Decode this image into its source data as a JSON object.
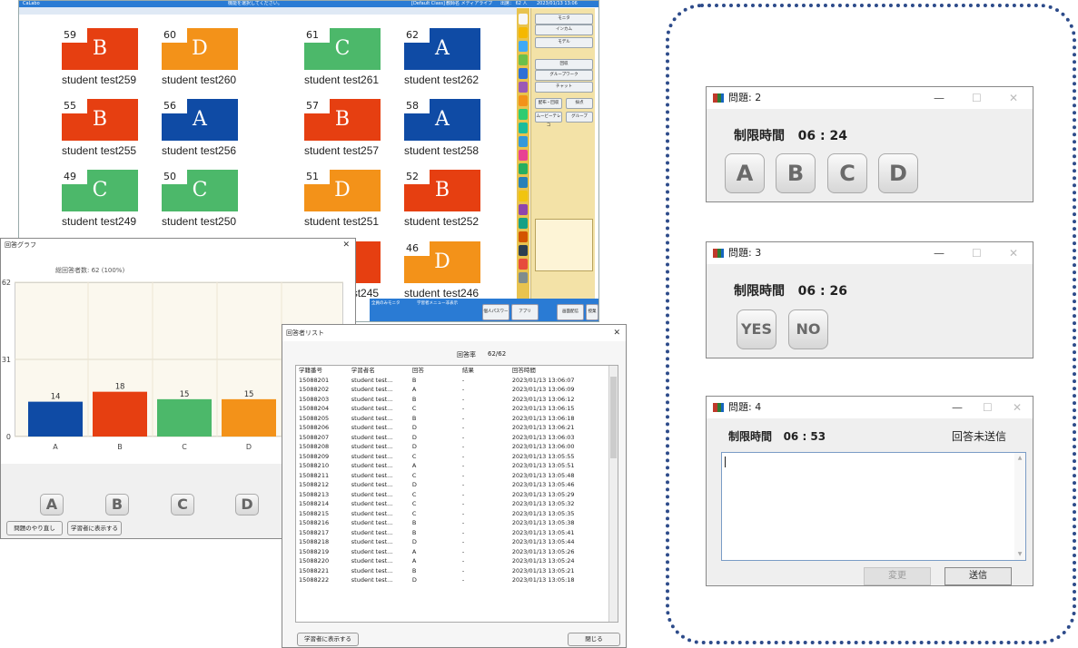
{
  "dashboard": {
    "topbar": {
      "app": "CaLabo",
      "message": "機能を選択してください。",
      "class": "[Default Class]",
      "teacher": "教師名 メディアライブ",
      "count": "出席： 62 人",
      "datetime": "2023/01/13 13:06"
    },
    "tiles": [
      {
        "num": "59",
        "letter": "B",
        "name": "student test259",
        "color": "#e63f11"
      },
      {
        "num": "60",
        "letter": "D",
        "name": "student test260",
        "color": "#f39219"
      },
      {
        "num": "61",
        "letter": "C",
        "name": "student test261",
        "color": "#4cb86a"
      },
      {
        "num": "62",
        "letter": "A",
        "name": "student test262",
        "color": "#0f4ba5"
      },
      {
        "num": "55",
        "letter": "B",
        "name": "student test255",
        "color": "#e63f11"
      },
      {
        "num": "56",
        "letter": "A",
        "name": "student test256",
        "color": "#0f4ba5"
      },
      {
        "num": "57",
        "letter": "B",
        "name": "student test257",
        "color": "#e63f11"
      },
      {
        "num": "58",
        "letter": "A",
        "name": "student test258",
        "color": "#0f4ba5"
      },
      {
        "num": "49",
        "letter": "C",
        "name": "student test249",
        "color": "#4cb86a"
      },
      {
        "num": "50",
        "letter": "C",
        "name": "student test250",
        "color": "#4cb86a"
      },
      {
        "num": "51",
        "letter": "D",
        "name": "student test251",
        "color": "#f39219"
      },
      {
        "num": "52",
        "letter": "B",
        "name": "student test252",
        "color": "#e63f11"
      },
      {
        "num": "",
        "letter": "",
        "name": "student test245",
        "color": "#e63f11"
      },
      {
        "num": "46",
        "letter": "D",
        "name": "student test246",
        "color": "#f39219"
      }
    ],
    "side_buttons": [
      "モニタ",
      "インカム",
      "モデル",
      "回収",
      "グループワーク",
      "チャット",
      "配布・回収",
      "採点",
      "ムービーテレコ",
      "グループ"
    ],
    "bottom_buttons": [
      "個人パスワード設定",
      "アプリ",
      "画面配信",
      "授業記録"
    ],
    "bottom_tabs": [
      "全員のみモニタ",
      "学習者メニュー非表示"
    ]
  },
  "graph": {
    "title": "回答グラフ",
    "close": "✕",
    "total_label": "総回答者数: 62 (100%)",
    "chart_data": {
      "type": "bar",
      "categories": [
        "A",
        "B",
        "C",
        "D"
      ],
      "values": [
        14,
        18,
        15,
        15
      ],
      "colors": [
        "#0f4ba5",
        "#e63f11",
        "#4cb86a",
        "#f39219"
      ],
      "yticks": [
        0,
        31,
        62
      ],
      "ylim": [
        0,
        62
      ],
      "grid": true
    },
    "buttons": [
      "A",
      "B",
      "C",
      "D"
    ],
    "redo": "問題のやり直し",
    "show": "学習者に表示する"
  },
  "answer_list": {
    "title": "回答者リスト",
    "close": "✕",
    "rate_label": "回答率",
    "rate_value": "62/62",
    "headers": [
      "学籍番号",
      "学習者名",
      "回答",
      "結果",
      "回答時間"
    ],
    "rows": [
      [
        "15088201",
        "student test...",
        "B",
        "-",
        "2023/01/13 13:06:07"
      ],
      [
        "15088202",
        "student test...",
        "A",
        "-",
        "2023/01/13 13:06:09"
      ],
      [
        "15088203",
        "student test...",
        "B",
        "-",
        "2023/01/13 13:06:12"
      ],
      [
        "15088204",
        "student test...",
        "C",
        "-",
        "2023/01/13 13:06:15"
      ],
      [
        "15088205",
        "student test...",
        "B",
        "-",
        "2023/01/13 13:06:18"
      ],
      [
        "15088206",
        "student test...",
        "D",
        "-",
        "2023/01/13 13:06:21"
      ],
      [
        "15088207",
        "student test...",
        "D",
        "-",
        "2023/01/13 13:06:03"
      ],
      [
        "15088208",
        "student test...",
        "D",
        "-",
        "2023/01/13 13:06:00"
      ],
      [
        "15088209",
        "student test...",
        "C",
        "-",
        "2023/01/13 13:05:55"
      ],
      [
        "15088210",
        "student test...",
        "A",
        "-",
        "2023/01/13 13:05:51"
      ],
      [
        "15088211",
        "student test...",
        "C",
        "-",
        "2023/01/13 13:05:48"
      ],
      [
        "15088212",
        "student test...",
        "D",
        "-",
        "2023/01/13 13:05:46"
      ],
      [
        "15088213",
        "student test...",
        "C",
        "-",
        "2023/01/13 13:05:29"
      ],
      [
        "15088214",
        "student test...",
        "C",
        "-",
        "2023/01/13 13:05:32"
      ],
      [
        "15088215",
        "student test...",
        "C",
        "-",
        "2023/01/13 13:05:35"
      ],
      [
        "15088216",
        "student test...",
        "B",
        "-",
        "2023/01/13 13:05:38"
      ],
      [
        "15088217",
        "student test...",
        "B",
        "-",
        "2023/01/13 13:05:41"
      ],
      [
        "15088218",
        "student test...",
        "D",
        "-",
        "2023/01/13 13:05:44"
      ],
      [
        "15088219",
        "student test...",
        "A",
        "-",
        "2023/01/13 13:05:26"
      ],
      [
        "15088220",
        "student test...",
        "A",
        "-",
        "2023/01/13 13:05:24"
      ],
      [
        "15088221",
        "student test...",
        "B",
        "-",
        "2023/01/13 13:05:21"
      ],
      [
        "15088222",
        "student test...",
        "D",
        "-",
        "2023/01/13 13:05:18"
      ]
    ],
    "show": "学習者に表示する",
    "close_btn": "閉じる"
  },
  "q2": {
    "title": "問題: 2",
    "timer_label": "制限時間",
    "timer": "06 : 24",
    "options": [
      "A",
      "B",
      "C",
      "D"
    ]
  },
  "q3": {
    "title": "問題: 3",
    "timer_label": "制限時間",
    "timer": "06 : 26",
    "options": [
      "YES",
      "NO"
    ]
  },
  "q4": {
    "title": "問題: 4",
    "timer_label": "制限時間",
    "timer": "06 : 53",
    "status": "回答未送信",
    "change": "変更",
    "send": "送信"
  },
  "window_controls": {
    "min": "—",
    "max": "☐",
    "close": "✕"
  }
}
